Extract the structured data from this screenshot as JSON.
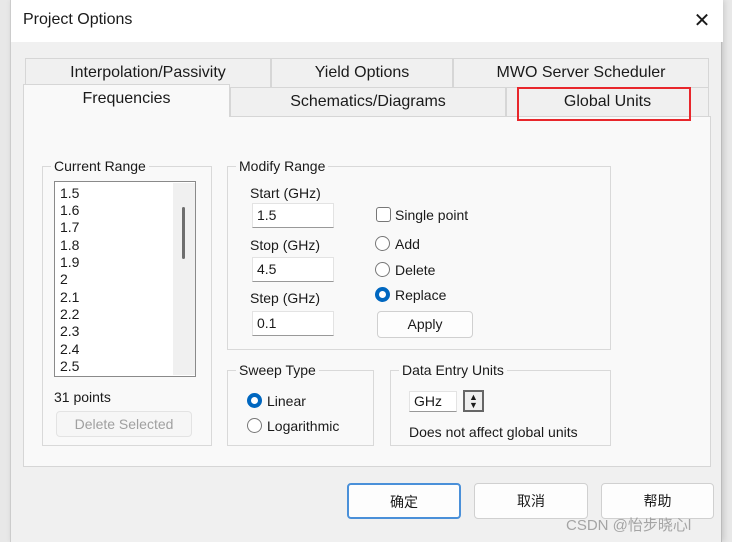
{
  "window": {
    "title": "Project Options",
    "close": "✕"
  },
  "tabs": {
    "row1": [
      "Interpolation/Passivity",
      "Yield Options",
      "MWO Server Scheduler"
    ],
    "row2": [
      "Frequencies",
      "Schematics/Diagrams",
      "Global Units"
    ],
    "selected": "Frequencies",
    "highlighted": "Global Units",
    "highlight_color": "#e8262b"
  },
  "current_range": {
    "legend": "Current Range",
    "items": [
      "1.5",
      "1.6",
      "1.7",
      "1.8",
      "1.9",
      "2",
      "2.1",
      "2.2",
      "2.3",
      "2.4",
      "2.5"
    ],
    "count": "31 points",
    "delete_button": "Delete Selected"
  },
  "modify_range": {
    "legend": "Modify Range",
    "start_label": "Start (GHz)",
    "start_value": "1.5",
    "stop_label": "Stop (GHz)",
    "stop_value": "4.5",
    "step_label": "Step (GHz)",
    "step_value": "0.1",
    "single_point": "Single point",
    "single_point_checked": false,
    "add": "Add",
    "delete": "Delete",
    "replace": "Replace",
    "mode": "Replace",
    "apply": "Apply"
  },
  "sweep_type": {
    "legend": "Sweep Type",
    "linear": "Linear",
    "log": "Logarithmic",
    "selected": "Linear"
  },
  "data_entry_units": {
    "legend": "Data Entry Units",
    "value": "GHz",
    "note": "Does not affect global units"
  },
  "buttons": {
    "ok": "确定",
    "cancel": "取消",
    "help": "帮助"
  },
  "watermark": "CSDN @怡步晓心l"
}
